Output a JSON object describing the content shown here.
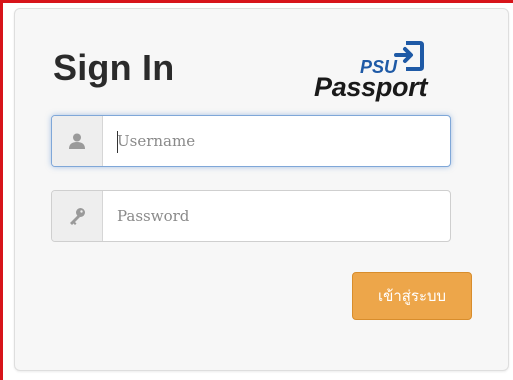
{
  "login": {
    "title": "Sign In",
    "logo": {
      "psu_text": "PSU",
      "passport_text": "Passport"
    },
    "username": {
      "placeholder": "Username",
      "value": "",
      "icon": "user-icon",
      "focused": true
    },
    "password": {
      "placeholder": "Password",
      "value": "",
      "icon": "key-icon"
    },
    "submit_label": "เข้าสู่ระบบ"
  },
  "colors": {
    "frame": "#d7141a",
    "button": "#eda64a",
    "logo_blue": "#1f5aa6",
    "focus_glow": "#7fa7d8"
  }
}
